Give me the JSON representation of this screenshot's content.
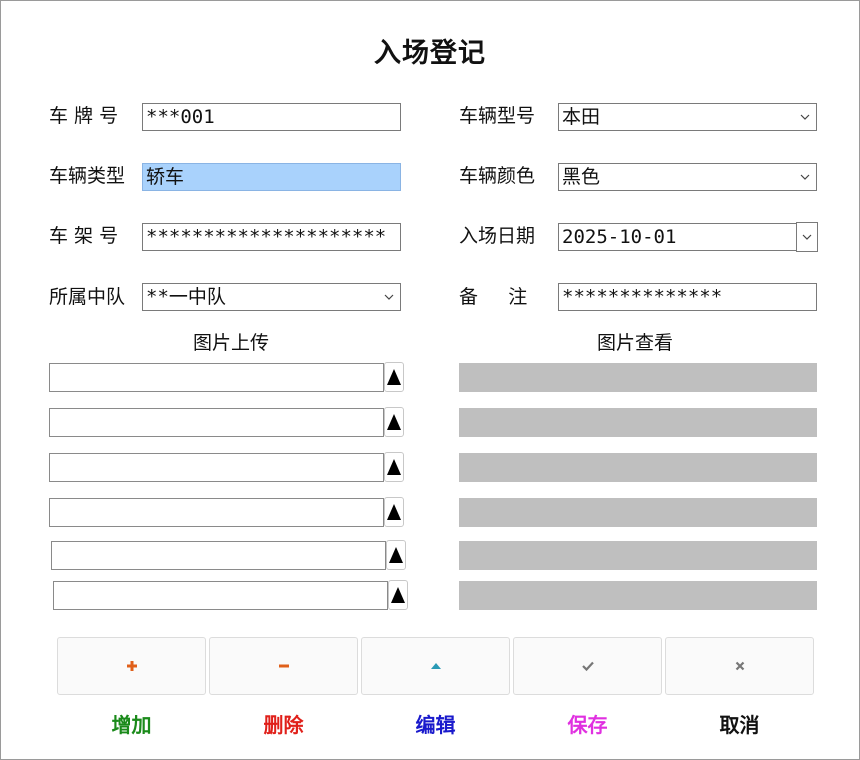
{
  "form": {
    "title": "入场登记",
    "plate_label": "车 牌 号",
    "plate_value": "***001",
    "model_label": "车辆型号",
    "model_value": "本田",
    "type_label": "车辆类型",
    "type_value": "轿车",
    "color_label": "车辆颜色",
    "color_value": "黑色",
    "frame_label": "车 架 号",
    "frame_value": "*********************",
    "date_label": "入场日期",
    "date_value": "2025-10-01",
    "team_label": "所属中队",
    "team_value": "**一中队",
    "remark_label": "备     注",
    "remark_value": "**************"
  },
  "upload": {
    "heading": "图片上传"
  },
  "viewer": {
    "heading": "图片查看"
  },
  "toolbar": {
    "add_label": "增加",
    "delete_label": "删除",
    "edit_label": "编辑",
    "save_label": "保存",
    "cancel_label": "取消"
  },
  "colors": {
    "add": "#1a8a1a",
    "delete": "#e0201a",
    "edit": "#1a1acc",
    "save": "#e030e0",
    "cancel": "#111111",
    "preview": "#bfbfbf",
    "selection": "#a9d2fc"
  },
  "icons": {
    "add": "plus-icon",
    "delete": "minus-icon",
    "edit": "triangle-up-icon",
    "save": "check-icon",
    "cancel": "close-icon",
    "upload": "upload-icon",
    "dropdown": "chevron-down-icon"
  }
}
